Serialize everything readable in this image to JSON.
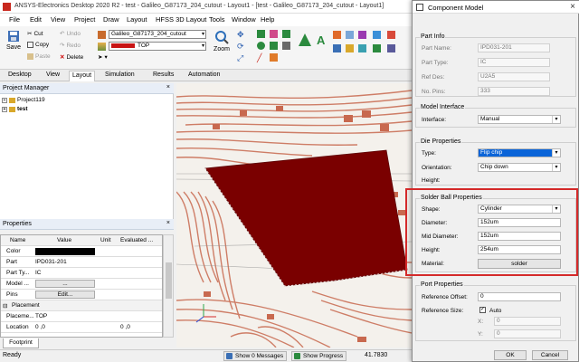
{
  "window": {
    "title": "ANSYS-Electronics Desktop 2020 R2 - test - Galileo_G87173_204_cutout - Layout1 - [test - Galileo_G87173_204_cutout - Layout1]"
  },
  "menu": [
    "File",
    "Edit",
    "View",
    "Project",
    "Draw",
    "Layout",
    "HFSS 3D Layout",
    "Tools",
    "Window",
    "Help"
  ],
  "toolbar": {
    "save": "Save",
    "cut": "Cut",
    "copy": "Copy",
    "paste": "Paste",
    "undo": "Undo",
    "redo": "Redo",
    "delete": "Delete",
    "design_select": "Galileo_G87173_204_cutout",
    "layer_select": "TOP",
    "zoom": "Zoom"
  },
  "ribbon_tabs": [
    "Desktop",
    "View",
    "Layout",
    "Simulation",
    "Results",
    "Automation"
  ],
  "ribbon_active": "Layout",
  "project_manager": {
    "title": "Project Manager",
    "items": [
      "Project119",
      "test"
    ]
  },
  "properties": {
    "title": "Properties",
    "columns": [
      "Name",
      "Value",
      "Unit",
      "Evaluated ..."
    ],
    "rows": [
      {
        "name": "Color",
        "value": "",
        "unit": "",
        "evaluated": ""
      },
      {
        "name": "Part",
        "value": "IPD031-201",
        "unit": "",
        "evaluated": ""
      },
      {
        "name": "Part Ty...",
        "value": "IC",
        "unit": "",
        "evaluated": ""
      },
      {
        "name": "Model ...",
        "value": "...",
        "unit": "",
        "evaluated": ""
      },
      {
        "name": "Pins",
        "value": "Edit...",
        "unit": "",
        "evaluated": ""
      },
      {
        "name": "Placement",
        "value": "",
        "unit": "",
        "evaluated": ""
      },
      {
        "name": "Placeme...",
        "value": "TOP",
        "unit": "",
        "evaluated": ""
      },
      {
        "name": "Location",
        "value": "0 ,0",
        "unit": "",
        "evaluated": "0 ,0"
      }
    ],
    "footer_tab": "Footprint"
  },
  "statusbar": {
    "ready": "Ready",
    "messages": "Show 0 Messages",
    "progress": "Show Progress",
    "coord": "41.7830"
  },
  "dialog": {
    "title": "Component Model",
    "close": "×",
    "part_info": {
      "title": "Part Info",
      "part_name_label": "Part Name:",
      "part_name": "IPD031-201",
      "part_type_label": "Part Type:",
      "part_type": "IC",
      "ref_des_label": "Ref Des:",
      "ref_des": "U2A5",
      "no_pins_label": "No. Pins:",
      "no_pins": "333"
    },
    "model_interface": {
      "title": "Model Interface",
      "interface_label": "Interface:",
      "interface": "Manual"
    },
    "die_properties": {
      "title": "Die Properties",
      "type_label": "Type:",
      "type": "Flip chip",
      "orientation_label": "Orientation:",
      "orientation": "Chip down",
      "height_label": "Height:",
      "height": ""
    },
    "solder_ball": {
      "title": "Solder Ball Properties",
      "shape_label": "Shape:",
      "shape": "Cylinder",
      "diameter_label": "Diameter:",
      "diameter": "152um",
      "mid_diameter_label": "Mid Diameter:",
      "mid_diameter": "152um",
      "height_label": "Height:",
      "height": "254um",
      "material_label": "Material:",
      "material": "solder"
    },
    "port_properties": {
      "title": "Port Properties",
      "ref_offset_label": "Reference Offset:",
      "ref_offset": "0",
      "ref_size_label": "Reference Size:",
      "auto_label": "Auto",
      "x_label": "X:",
      "x": "0",
      "y_label": "Y:",
      "y": "0"
    },
    "ok": "OK",
    "cancel": "Cancel"
  },
  "colors": {
    "die": "#7a0000",
    "highlight": "#d42a2a",
    "trace": "#c8694f",
    "selection": "#0a64d8"
  }
}
